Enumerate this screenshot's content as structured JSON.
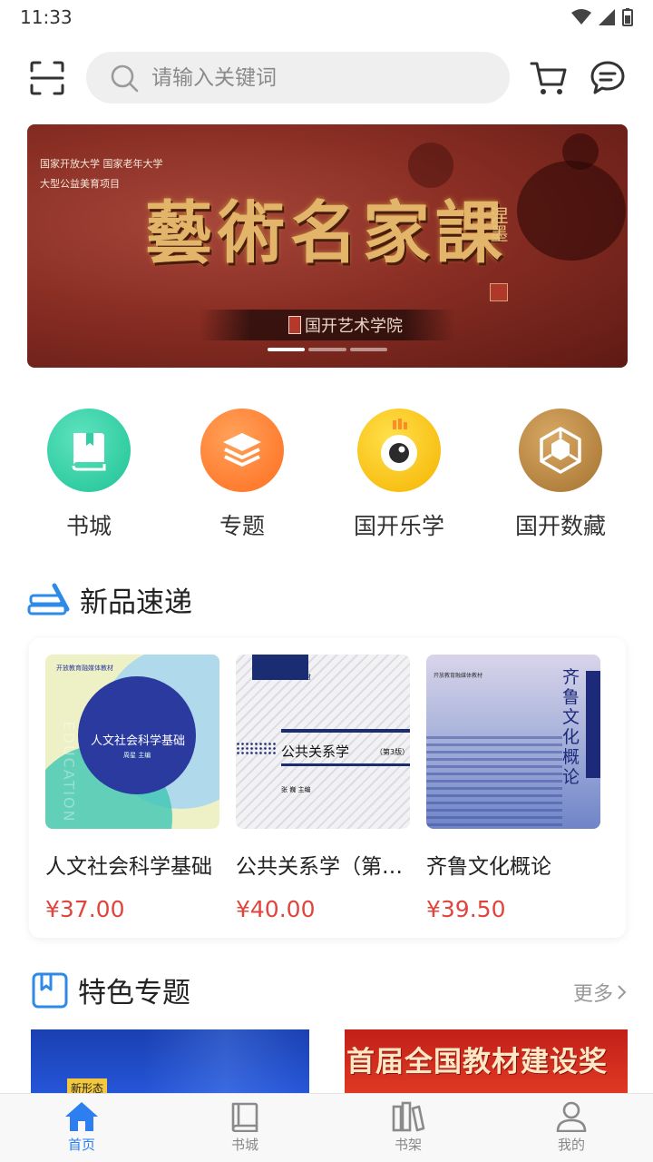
{
  "status_bar": {
    "time": "11:33"
  },
  "search": {
    "placeholder": "请输入关键词"
  },
  "banner": {
    "small_line1": "国家开放大学  国家老年大学",
    "small_line2": "大型公益美育项目",
    "title": "藝術名家課",
    "signature": "涅墨",
    "bar_text": "国开艺术学院"
  },
  "categories": [
    {
      "label": "书城",
      "icon": "book-icon",
      "color": "#2fcfa4"
    },
    {
      "label": "专题",
      "icon": "layers-icon",
      "color": "#ff7a2e"
    },
    {
      "label": "国开乐学",
      "icon": "eye-icon",
      "color": "#f6c417"
    },
    {
      "label": "国开数藏",
      "icon": "cube-icon",
      "color": "#b88640"
    }
  ],
  "new_products": {
    "title": "新品速递",
    "items": [
      {
        "name": "人文社会科学基础",
        "price": "¥37.00",
        "cover_title": "人文社会科学基础",
        "cover_top": "开放教育融媒体教材",
        "cover_author": "周星 主编",
        "cover_side": "EDUCATION"
      },
      {
        "name": "公共关系学（第3版）",
        "price": "¥40.00",
        "cover_title": "公共关系学",
        "cover_edition": "（第3版）",
        "cover_top": "开放教育融媒体教材",
        "cover_author": "张 巍 主编"
      },
      {
        "name": "齐鲁文化概论",
        "price": "¥39.50",
        "cover_title": "齐鲁文化概论",
        "cover_top": "开放教育融媒体教材"
      }
    ]
  },
  "topics": {
    "title": "特色专题",
    "more": "更多",
    "left_badge": "新形态",
    "right_text": "首届全国教材建设奖"
  },
  "bottom_nav": [
    {
      "label": "首页",
      "icon": "home-icon",
      "active": true
    },
    {
      "label": "书城",
      "icon": "book-icon",
      "active": false
    },
    {
      "label": "书架",
      "icon": "shelf-icon",
      "active": false
    },
    {
      "label": "我的",
      "icon": "user-icon",
      "active": false
    }
  ],
  "colors": {
    "accent": "#2d7ff0",
    "price": "#e0453d"
  }
}
